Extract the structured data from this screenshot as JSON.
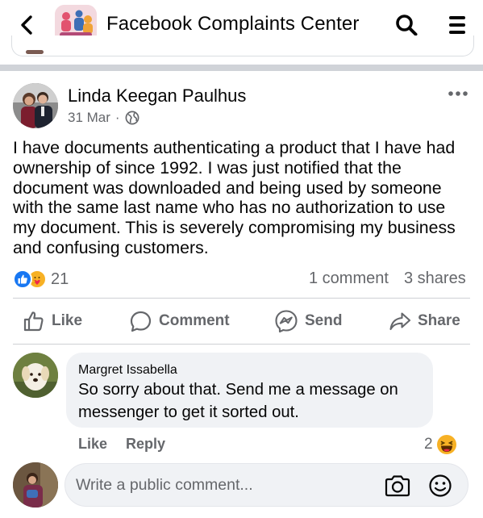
{
  "header": {
    "title": "Facebook Complaints Center",
    "back_icon": "chevron-left-icon",
    "search_icon": "search-icon",
    "menu_icon": "hamburger-menu-icon"
  },
  "post": {
    "author": "Linda Keegan Paulhus",
    "date": "31 Mar",
    "separator": "·",
    "privacy_icon": "globe-icon",
    "body": "I have documents authenticating a product that I have had\nownership of since 1992.  I was just notified that the\ndocument was downloaded and being used by someone\nwith the same last name who has no authorization to use\nmy document.  This is severely compromising my business\nand confusing customers.",
    "reaction_count": "21",
    "reaction_icons": [
      "like-reaction-icon",
      "care-reaction-icon"
    ],
    "comments_text": "1 comment",
    "shares_text": "3 shares"
  },
  "actions": {
    "like": "Like",
    "comment": "Comment",
    "send": "Send",
    "share": "Share"
  },
  "comment": {
    "author": "Margret Issabella",
    "text": "So sorry about that.  Send me a message on messenger to get it sorted out.",
    "like_label": "Like",
    "reply_label": "Reply",
    "reaction_count": "2",
    "reaction_icon": "haha-reaction-icon"
  },
  "composer": {
    "placeholder": "Write a public comment...",
    "camera_icon": "camera-icon",
    "emoji_icon": "emoji-icon"
  },
  "colors": {
    "text_primary": "#050505",
    "text_secondary": "#65676b",
    "brand_blue": "#1877f2",
    "bubble_bg": "#f0f2f5",
    "divider": "#ced0d4"
  }
}
